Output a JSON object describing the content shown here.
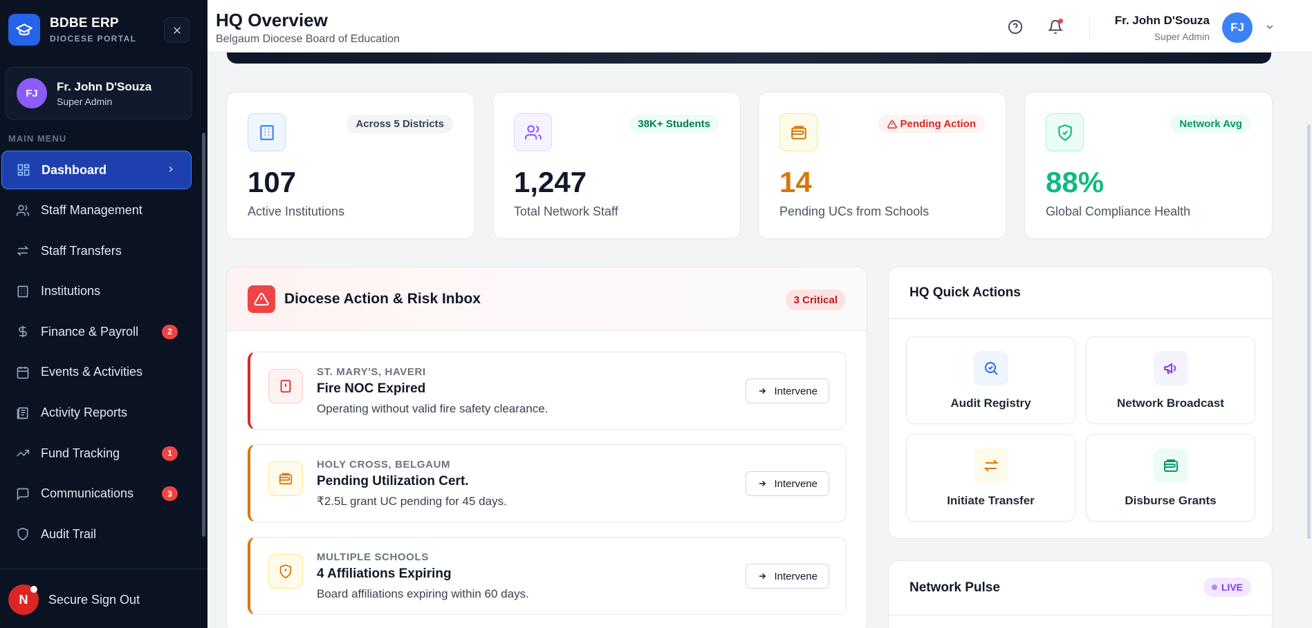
{
  "brand": {
    "title": "BDBE ERP",
    "subtitle": "DIOCESE PORTAL"
  },
  "sidebar_user": {
    "initials": "FJ",
    "name": "Fr. John D'Souza",
    "role": "Super Admin"
  },
  "menu_title": "MAIN MENU",
  "menu": [
    {
      "label": "Dashboard",
      "icon": "dashboard-icon",
      "active": true
    },
    {
      "label": "Staff Management",
      "icon": "users-icon"
    },
    {
      "label": "Staff Transfers",
      "icon": "transfer-icon"
    },
    {
      "label": "Institutions",
      "icon": "building-icon"
    },
    {
      "label": "Finance & Payroll",
      "icon": "dollar-icon",
      "badge": "2"
    },
    {
      "label": "Events & Activities",
      "icon": "calendar-icon"
    },
    {
      "label": "Activity Reports",
      "icon": "report-icon"
    },
    {
      "label": "Fund Tracking",
      "icon": "trend-icon",
      "badge": "1"
    },
    {
      "label": "Communications",
      "icon": "message-icon",
      "badge": "3"
    },
    {
      "label": "Audit Trail",
      "icon": "shield-icon"
    }
  ],
  "signout": {
    "avatar": "N",
    "label": "Secure Sign Out"
  },
  "header": {
    "title": "HQ Overview",
    "subtitle": "Belgaum Diocese Board of Education",
    "user_name": "Fr. John D'Souza",
    "user_role": "Super Admin",
    "user_initials": "FJ"
  },
  "stats": [
    {
      "pill": "Across 5 Districts",
      "value": "107",
      "label": "Active Institutions"
    },
    {
      "pill": "38K+ Students",
      "value": "1,247",
      "label": "Total Network Staff"
    },
    {
      "pill": "Pending Action",
      "value": "14",
      "label": "Pending UCs from Schools"
    },
    {
      "pill": "Network Avg",
      "value": "88%",
      "label": "Global Compliance Health"
    }
  ],
  "inbox": {
    "title": "Diocese Action & Risk Inbox",
    "critical": "3 Critical",
    "intervene_label": "Intervene",
    "items": [
      {
        "school": "ST. MARY'S, HAVERI",
        "title": "Fire NOC Expired",
        "desc": "Operating without valid fire safety clearance."
      },
      {
        "school": "HOLY CROSS, BELGAUM",
        "title": "Pending Utilization Cert.",
        "desc": "₹2.5L grant UC pending for 45 days."
      },
      {
        "school": "MULTIPLE SCHOOLS",
        "title": "4 Affiliations Expiring",
        "desc": "Board affiliations expiring within 60 days."
      }
    ]
  },
  "quick_actions": {
    "title": "HQ Quick Actions",
    "items": [
      {
        "label": "Audit Registry"
      },
      {
        "label": "Network Broadcast"
      },
      {
        "label": "Initiate Transfer"
      },
      {
        "label": "Disburse Grants"
      }
    ]
  },
  "pulse": {
    "title": "Network Pulse",
    "live": "LIVE"
  },
  "colors": {
    "sidebar_bg": "#0b1222",
    "active_menu": "#1e40af",
    "brand_blue": "#2563eb",
    "danger": "#dc2626",
    "warning": "#d97706",
    "success": "#10b981"
  }
}
